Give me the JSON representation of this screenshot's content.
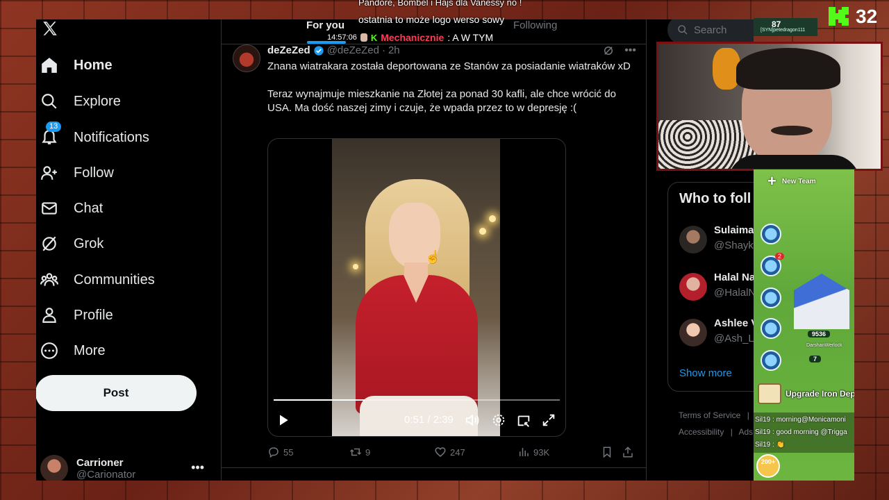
{
  "overlay": {
    "top_message_1": "Pandore, Bombel i Hajs dla Vanessy no !",
    "top_message_2": "ostatnia to może logo werso sowy",
    "clock": "14:57:06",
    "chat_user": "Mechanicznie",
    "chat_message": ": A W TYM",
    "viewer_count": "32"
  },
  "nav": {
    "items": [
      {
        "label": "Home",
        "icon": "home-icon",
        "active": true
      },
      {
        "label": "Explore",
        "icon": "search-icon"
      },
      {
        "label": "Notifications",
        "icon": "bell-icon",
        "badge": "13"
      },
      {
        "label": "Follow",
        "icon": "follow-icon"
      },
      {
        "label": "Chat",
        "icon": "mail-icon"
      },
      {
        "label": "Grok",
        "icon": "grok-icon"
      },
      {
        "label": "Communities",
        "icon": "communities-icon"
      },
      {
        "label": "Profile",
        "icon": "profile-icon"
      },
      {
        "label": "More",
        "icon": "more-circle-icon"
      }
    ],
    "post_label": "Post"
  },
  "account": {
    "name": "Carrioner",
    "handle": "@Carionator"
  },
  "tabs": {
    "for_you": "For you",
    "following": "Following"
  },
  "tweet": {
    "name": "deZeZed",
    "handle": "@deZeZed",
    "dot": "·",
    "time": "2h",
    "text": "Znana wiatrakara została deportowana ze Stanów za posiadanie wiatraków xD\n\nTeraz wynajmuje mieszkanie na Złotej za ponad 30 kafli, ale chce wrócić do USA. Ma dość naszej zimy i czuje, że wpada przez to w depresję :(",
    "video": {
      "time_display": "0:51 / 2:39",
      "progress_fraction": 0.32
    },
    "actions": {
      "replies": "55",
      "reposts": "9",
      "likes": "247",
      "views": "93K"
    }
  },
  "right": {
    "search_placeholder": "Search",
    "who_to_follow_title": "Who to foll",
    "suggestions": [
      {
        "name": "Sulaima",
        "handle": "@Shayk"
      },
      {
        "name": "Halal Na",
        "handle": "@HalalN"
      },
      {
        "name": "Ashlee V",
        "handle": "@Ash_Le"
      }
    ],
    "show_more": "Show more",
    "footer": {
      "terms": "Terms of Service",
      "sep1": "|",
      "accessibility": "Accessibility",
      "sep2": "|",
      "ads": "Ads"
    }
  },
  "game": {
    "top_number": "87",
    "top_user": "[SYN]petedragon111",
    "new_team": "New Team",
    "cart_badge": "2",
    "coins": "9536",
    "player_name": "DarshanWerlock",
    "stars": "7",
    "upgrade_label": "Upgrade Iron Depo",
    "chat": [
      "Sil19 : morning@Monicamoni",
      "Sil19 : good morning @Trigga",
      "Sil19 : 👏"
    ],
    "level": "200+"
  }
}
